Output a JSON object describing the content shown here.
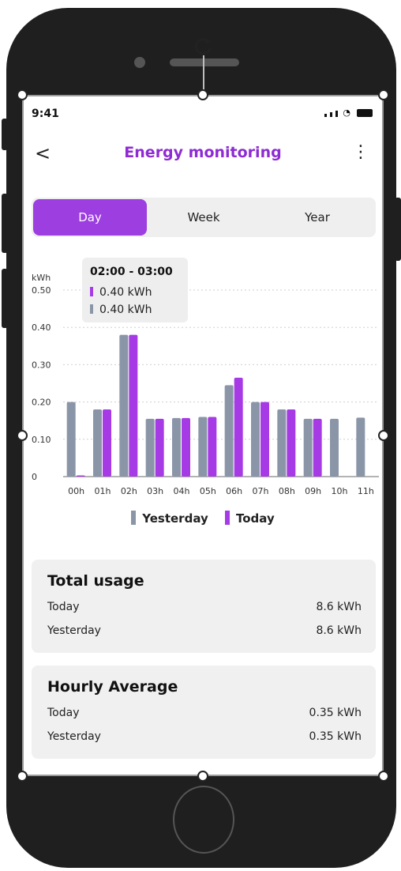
{
  "status_bar": {
    "time": "9:41"
  },
  "header": {
    "back_icon": "chevron-left-icon",
    "title": "Energy monitoring",
    "more_icon": "vertical-dots-icon"
  },
  "tabs": [
    {
      "label": "Day",
      "active": true
    },
    {
      "label": "Week",
      "active": false
    },
    {
      "label": "Year",
      "active": false
    }
  ],
  "tooltip": {
    "title": "02:00 - 03:00",
    "today": "0.40 kWh",
    "yesterday": "0.40 kWh"
  },
  "colors": {
    "accent": "#9c3ee0",
    "today": "#a63be6",
    "yesterday": "#8a96a8"
  },
  "chart_data": {
    "type": "bar",
    "ylabel": "kWh",
    "ylim": [
      0,
      0.5
    ],
    "y_ticks": [
      "0",
      "0.10",
      "0.20",
      "0.30",
      "0.40",
      "0.50"
    ],
    "categories": [
      "00h",
      "01h",
      "02h",
      "03h",
      "04h",
      "05h",
      "06h",
      "07h",
      "08h",
      "09h",
      "10h",
      "11h"
    ],
    "series": [
      {
        "name": "Yesterday",
        "values": [
          0.2,
          0.18,
          0.38,
          0.155,
          0.157,
          0.16,
          0.245,
          0.2,
          0.18,
          0.155,
          0.155,
          0.158
        ]
      },
      {
        "name": "Today",
        "values": [
          0.0,
          0.18,
          0.38,
          0.155,
          0.157,
          0.16,
          0.265,
          0.2,
          0.18,
          0.155,
          null,
          null
        ]
      }
    ],
    "grid": true,
    "legend": "bottom"
  },
  "total_usage": {
    "title": "Total usage",
    "rows": [
      {
        "label": "Today",
        "value": "8.6 kWh"
      },
      {
        "label": "Yesterday",
        "value": "8.6 kWh"
      }
    ]
  },
  "hourly_average": {
    "title": "Hourly Average",
    "rows": [
      {
        "label": "Today",
        "value": "0.35 kWh"
      },
      {
        "label": "Yesterday",
        "value": "0.35 kWh"
      }
    ]
  }
}
